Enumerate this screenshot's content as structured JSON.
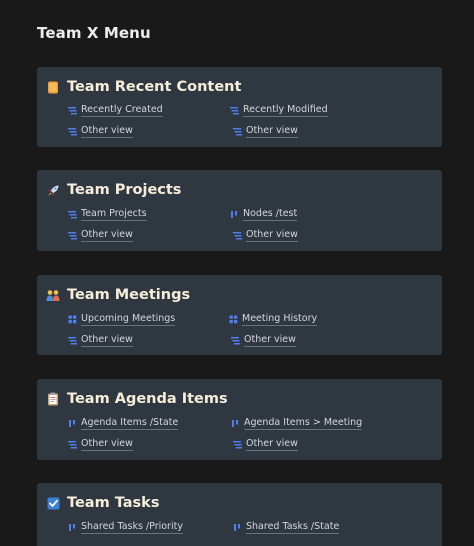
{
  "page": {
    "title": "Team X Menu"
  },
  "colors": {
    "background": "#191919",
    "card": "#2f3741",
    "card_title": "#f6eedb",
    "link_icon": "#4f7ef0"
  },
  "cards": [
    {
      "icon": "orange-book-icon",
      "title": "Team Recent Content",
      "links": [
        {
          "label": "Recently Created",
          "icon": "list-view-icon"
        },
        {
          "label": "Recently Modified",
          "icon": "list-view-icon"
        },
        {
          "label": "Other view",
          "icon": "list-view-icon"
        },
        {
          "label": "Other view",
          "icon": "list-view-icon"
        }
      ]
    },
    {
      "icon": "rocket-icon",
      "title": "Team Projects",
      "links": [
        {
          "label": "Team Projects",
          "icon": "list-view-icon"
        },
        {
          "label": "Nodes /test",
          "icon": "board-view-icon"
        },
        {
          "label": "Other view",
          "icon": "list-view-icon"
        },
        {
          "label": "Other view",
          "icon": "list-view-icon"
        }
      ]
    },
    {
      "icon": "people-icon",
      "title": "Team Meetings",
      "links": [
        {
          "label": "Upcoming Meetings",
          "icon": "grid-view-icon"
        },
        {
          "label": "Meeting History",
          "icon": "grid-view-icon"
        },
        {
          "label": "Other view",
          "icon": "list-view-icon"
        },
        {
          "label": "Other view",
          "icon": "list-view-icon"
        }
      ]
    },
    {
      "icon": "clipboard-icon",
      "title": "Team Agenda Items",
      "links": [
        {
          "label": "Agenda Items /State",
          "icon": "board-view-icon"
        },
        {
          "label": "Agenda Items > Meeting",
          "icon": "board-view-icon"
        },
        {
          "label": "Other view",
          "icon": "list-view-icon"
        },
        {
          "label": "Other view",
          "icon": "list-view-icon"
        }
      ]
    },
    {
      "icon": "checkbox-icon",
      "title": "Team Tasks",
      "links": [
        {
          "label": "Shared Tasks /Priority",
          "icon": "board-view-icon"
        },
        {
          "label": "Shared Tasks /State",
          "icon": "board-view-icon"
        }
      ]
    }
  ]
}
